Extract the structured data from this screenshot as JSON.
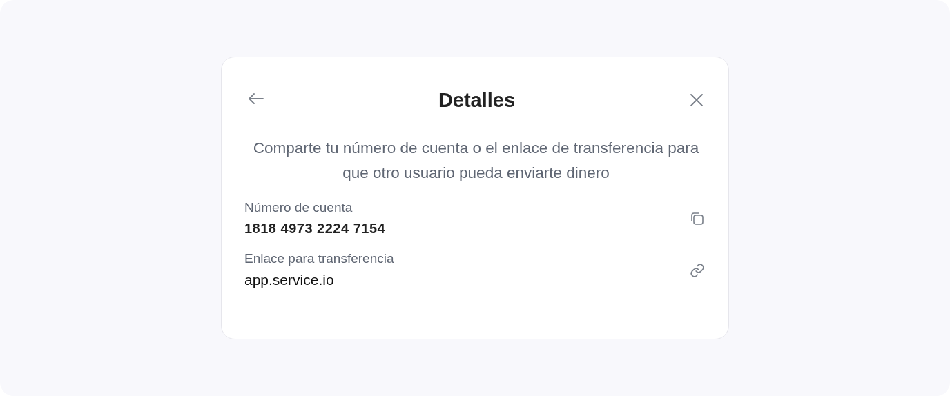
{
  "dialog": {
    "title": "Detalles",
    "description": "Comparte tu número de cuenta o el enlace de transferencia para que otro usuario pueda enviarte dinero",
    "fields": [
      {
        "kind": "copy",
        "label": "Número de cuenta",
        "value": "1818 4973 2224 7154"
      },
      {
        "kind": "link",
        "label": "Enlace para transferencia",
        "value": "app.service.io"
      }
    ]
  }
}
